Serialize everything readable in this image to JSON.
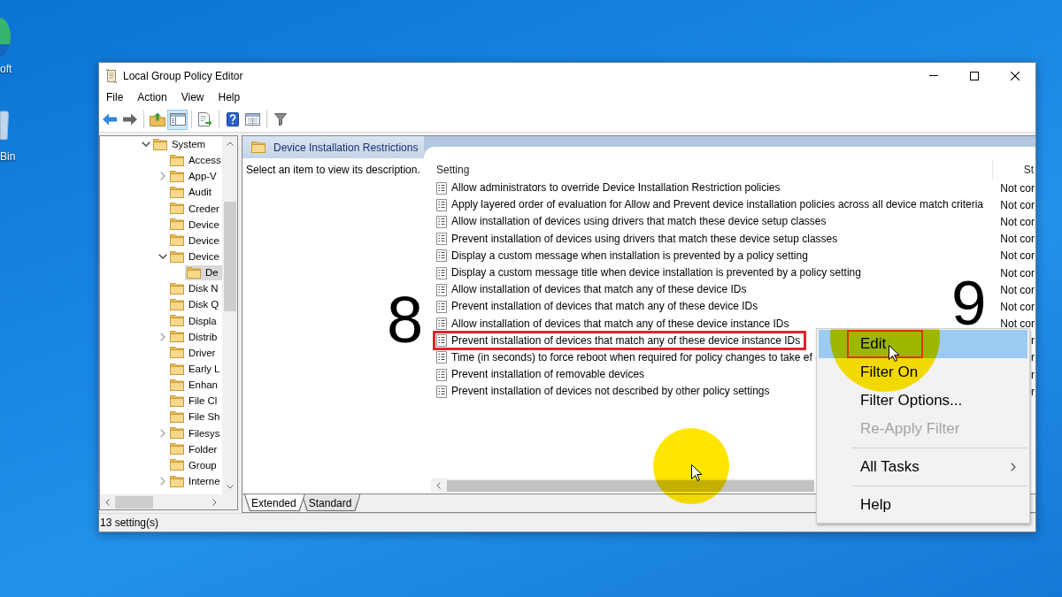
{
  "desktop": {
    "icons": [
      {
        "kind": "app",
        "label": "oft"
      },
      {
        "kind": "trash",
        "label": "Bin"
      }
    ]
  },
  "window": {
    "title": "Local Group Policy Editor",
    "menu": [
      "File",
      "Action",
      "View",
      "Help"
    ],
    "toolbar": [
      {
        "kind": "back",
        "pressed": false,
        "disabled": false
      },
      {
        "kind": "forward",
        "pressed": false,
        "disabled": true
      },
      {
        "kind": "separator"
      },
      {
        "kind": "up",
        "pressed": false,
        "disabled": false
      },
      {
        "kind": "tree",
        "pressed": true,
        "disabled": false
      },
      {
        "kind": "separator"
      },
      {
        "kind": "export",
        "pressed": false,
        "disabled": false
      },
      {
        "kind": "separator"
      },
      {
        "kind": "help",
        "pressed": false,
        "disabled": false
      },
      {
        "kind": "properties",
        "pressed": false,
        "disabled": false
      },
      {
        "kind": "separator"
      },
      {
        "kind": "filter",
        "pressed": false,
        "disabled": false
      }
    ]
  },
  "tree": {
    "items": [
      {
        "label": "System",
        "expanded": true,
        "selected": false,
        "children": [
          {
            "label": "Access",
            "selected": false
          },
          {
            "label": "App-V",
            "expanded": false,
            "selected": false
          },
          {
            "label": "Audit",
            "selected": false
          },
          {
            "label": "Creder",
            "selected": false
          },
          {
            "label": "Device",
            "selected": false
          },
          {
            "label": "Device",
            "selected": false
          },
          {
            "label": "Device",
            "expanded": true,
            "selected": false,
            "children": [
              {
                "label": "De",
                "selected": true
              }
            ]
          },
          {
            "label": "Disk N",
            "selected": false
          },
          {
            "label": "Disk Q",
            "selected": false
          },
          {
            "label": "Displa",
            "selected": false
          },
          {
            "label": "Distrib",
            "expanded": false,
            "selected": false
          },
          {
            "label": "Driver",
            "selected": false
          },
          {
            "label": "Early L",
            "selected": false
          },
          {
            "label": "Enhan",
            "selected": false
          },
          {
            "label": "File Cl",
            "selected": false
          },
          {
            "label": "File Sh",
            "selected": false
          },
          {
            "label": "Filesys",
            "expanded": false,
            "selected": false
          },
          {
            "label": "Folder",
            "selected": false
          },
          {
            "label": "Group",
            "selected": false
          },
          {
            "label": "Interne",
            "expanded": false,
            "selected": false
          }
        ]
      }
    ]
  },
  "details": {
    "header": "Device Installation Restrictions",
    "description": "Select an item to view its description.",
    "columns": [
      "Setting",
      "St"
    ],
    "rows": [
      {
        "setting": "Allow administrators to override Device Installation Restriction policies",
        "state": "Not cor",
        "selected": false,
        "marked": false
      },
      {
        "setting": "Apply layered order of evaluation for Allow and Prevent device installation policies across all device match criteria",
        "state": "Not cor",
        "selected": false,
        "marked": false
      },
      {
        "setting": "Allow installation of devices using drivers that match these device setup classes",
        "state": "Not cor",
        "selected": false,
        "marked": false
      },
      {
        "setting": "Prevent installation of devices using drivers that match these device setup classes",
        "state": "Not cor",
        "selected": false,
        "marked": false
      },
      {
        "setting": "Display a custom message when installation is prevented by a policy setting",
        "state": "Not cor",
        "selected": false,
        "marked": false
      },
      {
        "setting": "Display a custom message title when device installation is prevented by a policy setting",
        "state": "Not cor",
        "selected": false,
        "marked": false
      },
      {
        "setting": "Allow installation of devices that match any of these device IDs",
        "state": "Not cor",
        "selected": false,
        "marked": false
      },
      {
        "setting": "Prevent installation of devices that match any of these device IDs",
        "state": "Not cor",
        "selected": false,
        "marked": false
      },
      {
        "setting": "Allow installation of devices that match any of these device instance IDs",
        "state": "Not cor",
        "selected": false,
        "marked": false
      },
      {
        "setting": "Prevent installation of devices that match any of these device instance IDs",
        "state": "r",
        "selected": false,
        "marked": true
      },
      {
        "setting": "Time (in seconds) to force reboot when required for policy changes to take ef",
        "state": "r",
        "selected": false,
        "marked": false
      },
      {
        "setting": "Prevent installation of removable devices",
        "state": "r",
        "selected": false,
        "marked": false
      },
      {
        "setting": "Prevent installation of devices not described by other policy settings",
        "state": "r",
        "selected": false,
        "marked": false
      }
    ],
    "tabs": [
      {
        "label": "Extended",
        "selected": true
      },
      {
        "label": "Standard",
        "selected": false
      }
    ]
  },
  "status_bar": "13 setting(s)",
  "context_menu": {
    "items": [
      {
        "kind": "item",
        "label": "Edit",
        "selected": true,
        "disabled": false,
        "submenu": false,
        "marked": true
      },
      {
        "kind": "item",
        "label": "Filter On",
        "selected": false,
        "disabled": false,
        "submenu": false,
        "marked": false
      },
      {
        "kind": "item",
        "label": "Filter Options...",
        "selected": false,
        "disabled": false,
        "submenu": false,
        "marked": false
      },
      {
        "kind": "item",
        "label": "Re-Apply Filter",
        "selected": false,
        "disabled": true,
        "submenu": false,
        "marked": false
      },
      {
        "kind": "separator"
      },
      {
        "kind": "item",
        "label": "All Tasks",
        "selected": false,
        "disabled": false,
        "submenu": true,
        "marked": false
      },
      {
        "kind": "separator"
      },
      {
        "kind": "item",
        "label": "Help",
        "selected": false,
        "disabled": false,
        "submenu": false,
        "marked": false
      }
    ]
  },
  "step_labels": [
    "8",
    "9"
  ]
}
